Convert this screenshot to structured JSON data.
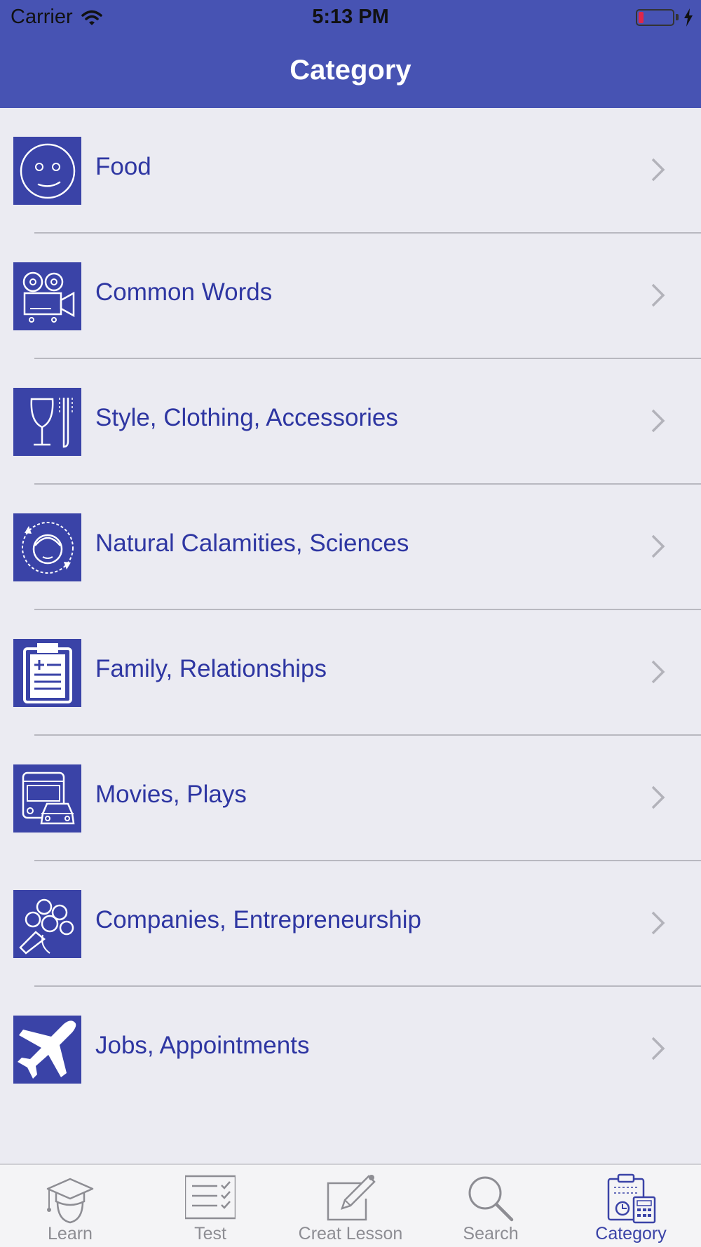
{
  "status_bar": {
    "carrier": "Carrier",
    "time": "5:13 PM"
  },
  "header": {
    "title": "Category"
  },
  "categories": [
    {
      "label": "Food",
      "icon": "smiley-face-icon"
    },
    {
      "label": "Common Words",
      "icon": "movie-camera-icon"
    },
    {
      "label": "Style, Clothing, Accessories",
      "icon": "glass-fork-icon"
    },
    {
      "label": "Natural Calamities, Sciences",
      "icon": "face-cycle-icon"
    },
    {
      "label": "Family, Relationships",
      "icon": "medical-clipboard-icon"
    },
    {
      "label": "Movies, Plays",
      "icon": "bus-car-icon"
    },
    {
      "label": "Companies, Entrepreneurship",
      "icon": "flower-bouquet-icon"
    },
    {
      "label": "Jobs, Appointments",
      "icon": "airplane-icon"
    }
  ],
  "tabs": [
    {
      "label": "Learn",
      "icon": "graduation-cap-icon",
      "active": false
    },
    {
      "label": "Test",
      "icon": "checklist-icon",
      "active": false
    },
    {
      "label": "Creat Lesson",
      "icon": "pencil-note-icon",
      "active": false
    },
    {
      "label": "Search",
      "icon": "search-icon",
      "active": false
    },
    {
      "label": "Category",
      "icon": "calculator-clipboard-icon",
      "active": true
    }
  ],
  "colors": {
    "header_bg": "#4753b3",
    "accent": "#3a43a7",
    "list_bg": "#ebebf2",
    "battery_low": "#e0264a"
  }
}
